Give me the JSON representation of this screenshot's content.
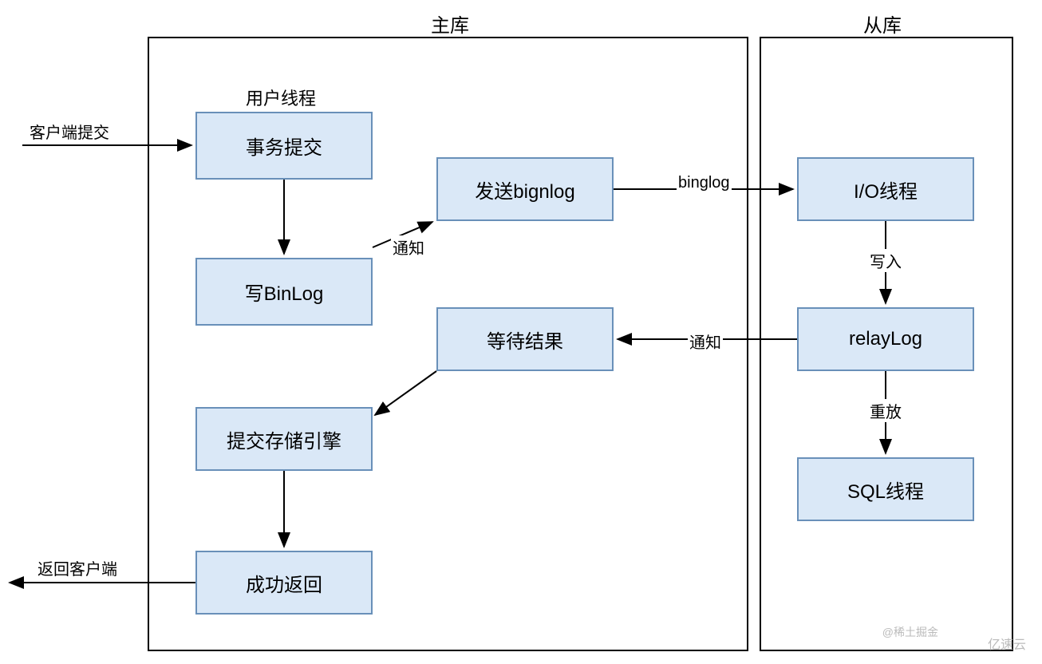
{
  "containers": {
    "master": {
      "label": "主库"
    },
    "slave": {
      "label": "从库"
    }
  },
  "sublabels": {
    "user_thread": "用户线程"
  },
  "nodes": {
    "tx_commit": "事务提交",
    "write_binlog": "写BinLog",
    "send_binlog": "发送bignlog",
    "wait_result": "等待结果",
    "commit_engine": "提交存储引擎",
    "return_success": "成功返回",
    "io_thread": "I/O线程",
    "relay_log": "relayLog",
    "sql_thread": "SQL线程"
  },
  "edges": {
    "client_submit": "客户端提交",
    "return_client": "返回客户端",
    "notify1": "通知",
    "binglog": "binglog",
    "write_in": "写入",
    "notify2": "通知",
    "replay": "重放"
  },
  "watermarks": {
    "juejin": "@稀土掘金",
    "yisu": "亿速云"
  }
}
